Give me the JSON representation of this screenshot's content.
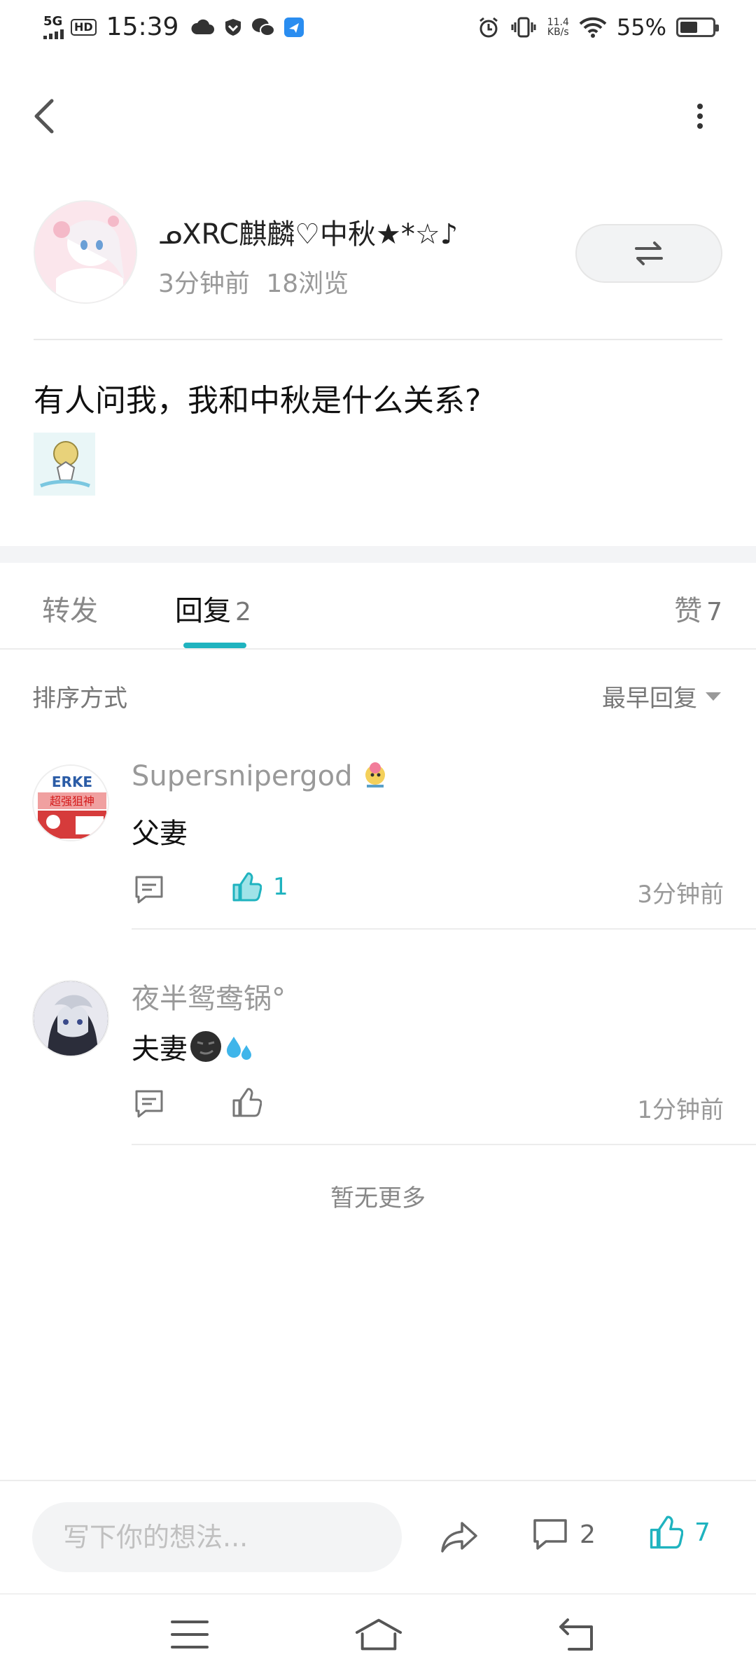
{
  "status_bar": {
    "network": "5G",
    "hd": "HD",
    "time": "15:39",
    "speed_value": "11.4",
    "speed_unit": "KB/s",
    "battery": "55%",
    "battery_level": 0.55
  },
  "post": {
    "author": "ᓄXRC麒麟♡中秋★*☆♪",
    "time_ago": "3分钟前",
    "views": "18浏览",
    "text": "有人问我，我和中秋是什么关系?"
  },
  "tabs": [
    {
      "label": "转发",
      "count": ""
    },
    {
      "label": "回复",
      "count": "2"
    },
    {
      "label": "赞",
      "count": "7"
    }
  ],
  "sort": {
    "label": "排序方式",
    "value": "最早回复"
  },
  "comments": [
    {
      "name": "Supersnipergod",
      "text": "父妻",
      "likes": "1",
      "time": "3分钟前",
      "avatar_text": "ERKE",
      "avatar_caption": "超强狙神"
    },
    {
      "name": "夜半鸳鸯锅°",
      "text": "夫妻",
      "likes": "",
      "time": "1分钟前"
    }
  ],
  "no_more": "暂无更多",
  "bottom": {
    "input_placeholder": "写下你的想法...",
    "comment_count": "2",
    "like_count": "7"
  },
  "colors": {
    "accent": "#1fb3bf",
    "muted": "#999999"
  },
  "icons": [
    "back-icon",
    "more-icon",
    "swap-icon",
    "reply-icon",
    "like-icon",
    "share-icon",
    "comment-icon",
    "menu-icon",
    "home-icon",
    "return-icon"
  ]
}
